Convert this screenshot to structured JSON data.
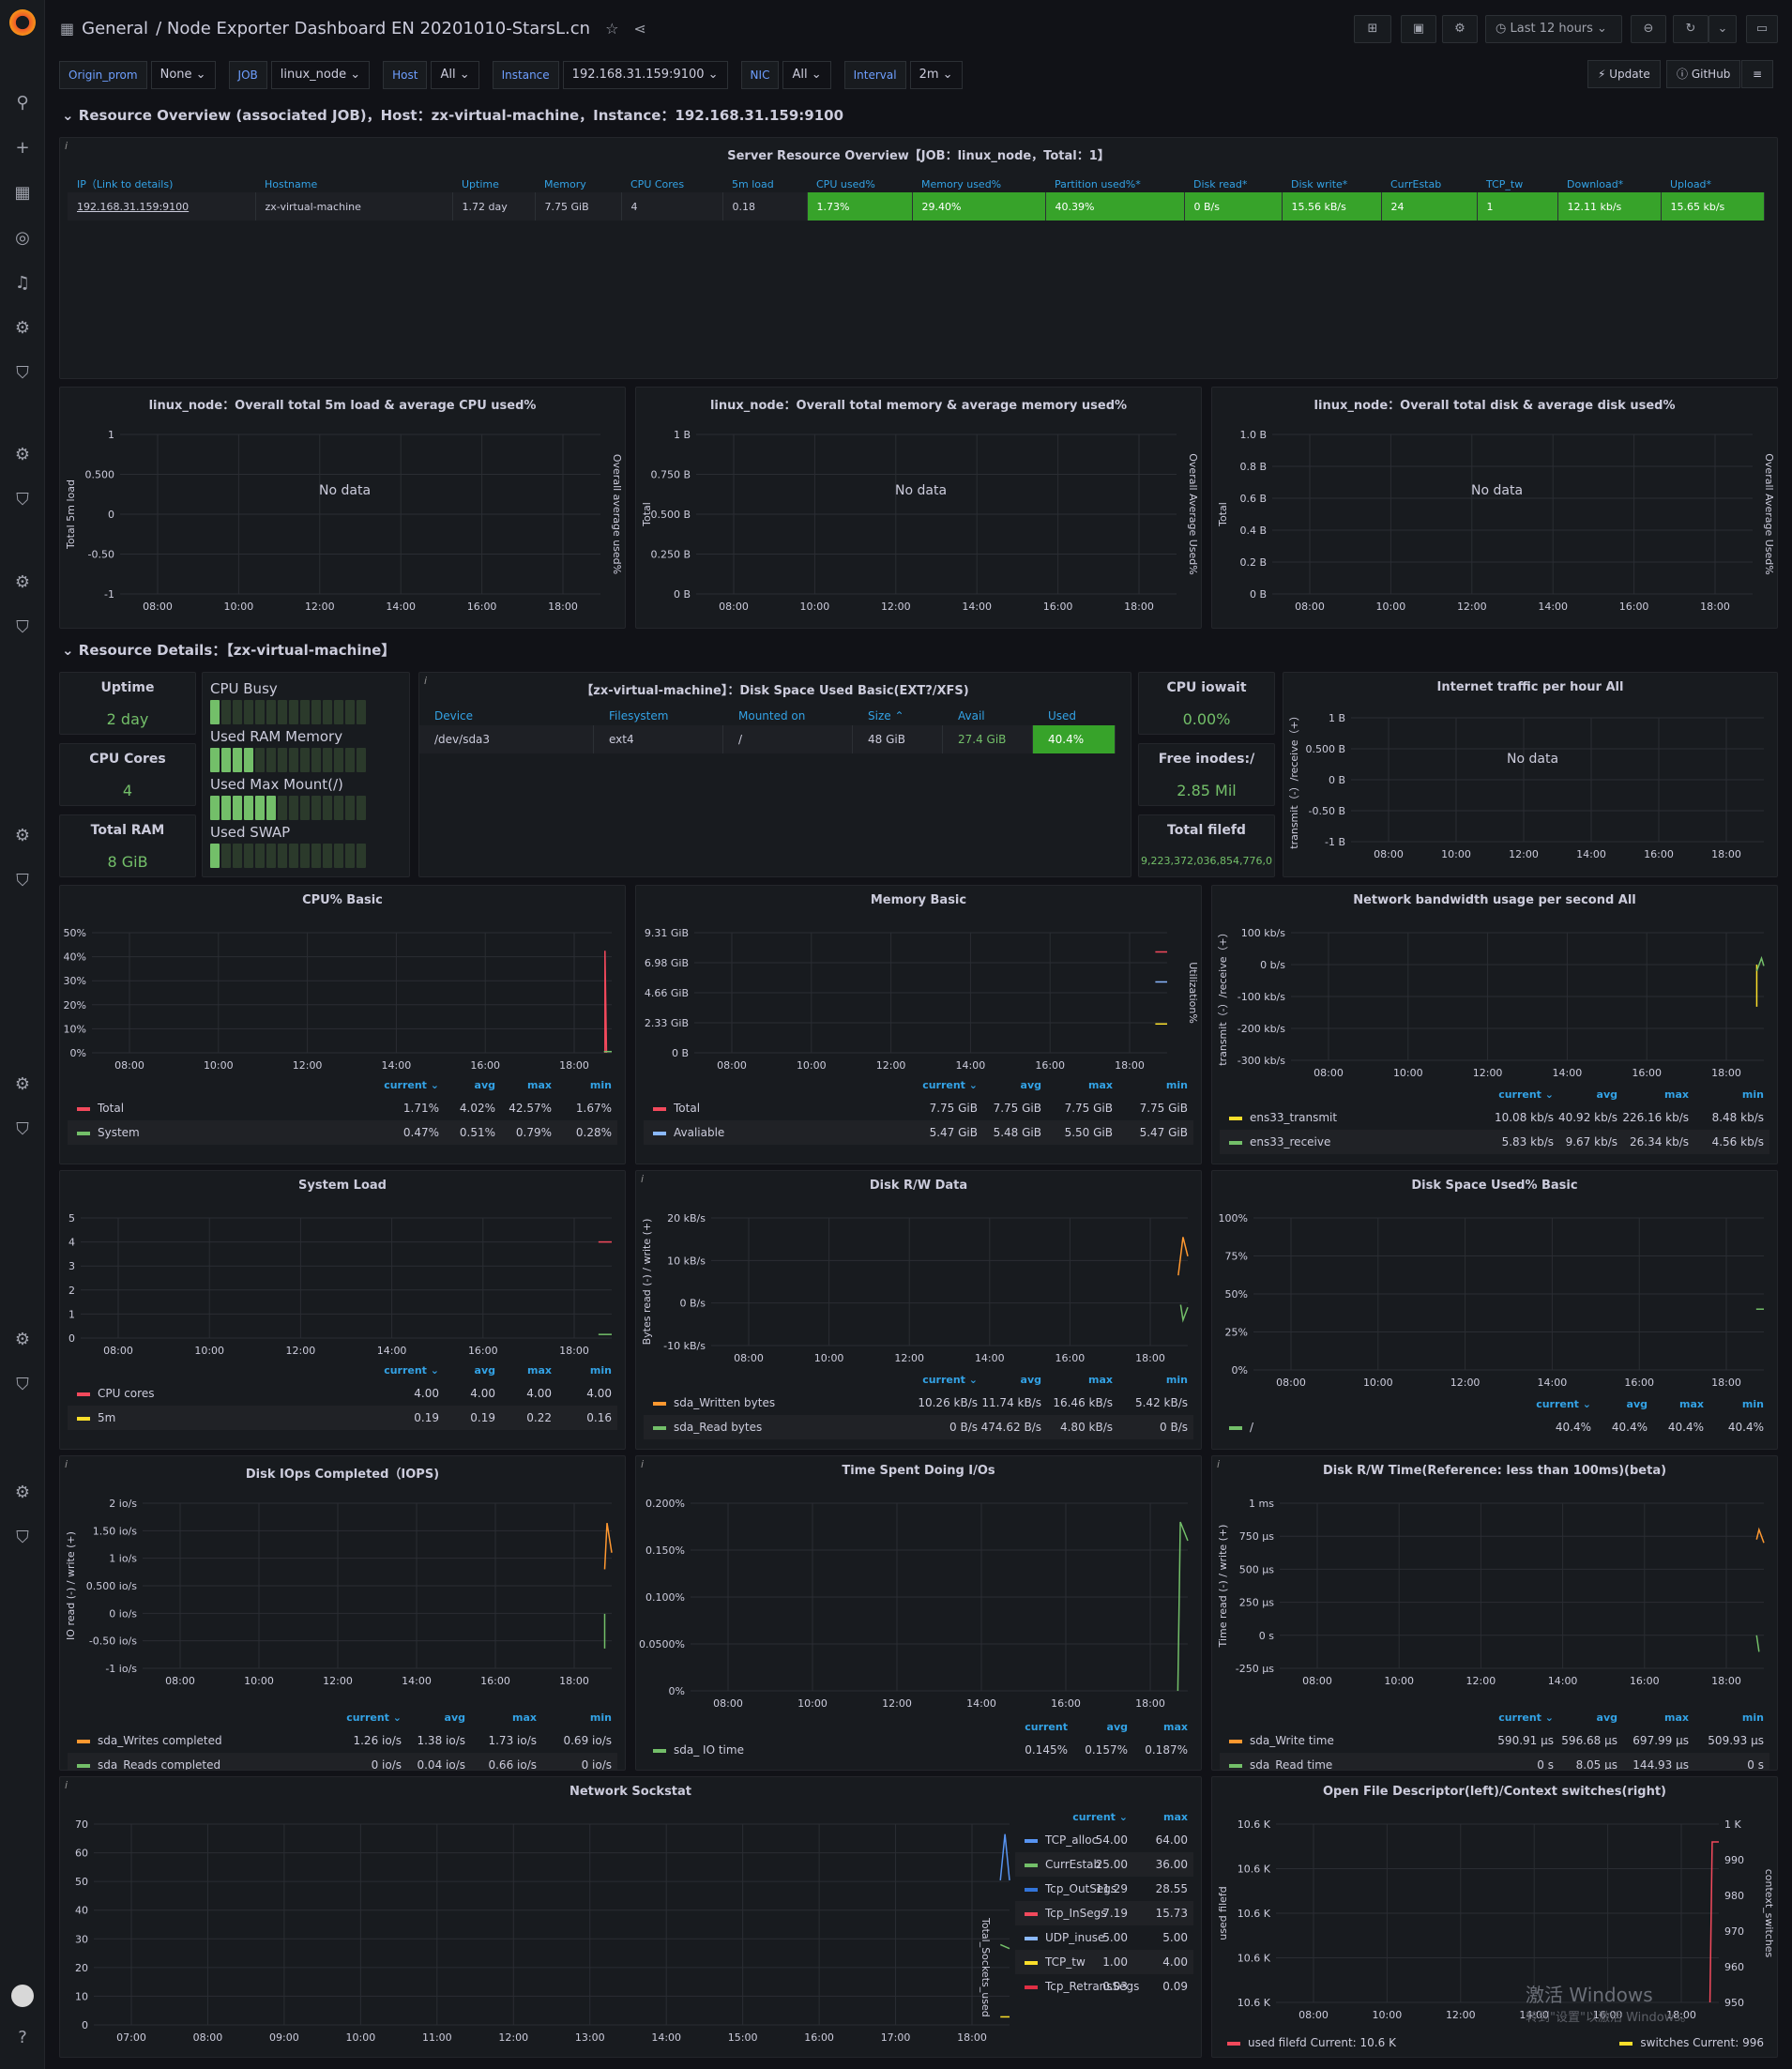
{
  "topbar": {
    "folder": "General",
    "title": "/ Node Exporter Dashboard EN 20201010-StarsL.cn",
    "time_range": "Last 12 hours"
  },
  "variables": [
    {
      "label": "Origin_prom",
      "value": "None"
    },
    {
      "label": "JOB",
      "value": "linux_node"
    },
    {
      "label": "Host",
      "value": "All"
    },
    {
      "label": "Instance",
      "value": "192.168.31.159:9100"
    },
    {
      "label": "NIC",
      "value": "All"
    },
    {
      "label": "Interval",
      "value": "2m"
    }
  ],
  "links": {
    "update": "Update",
    "github": "GitHub"
  },
  "rows": {
    "overview": "Resource Overview (associated JOB)，Host：zx-virtual-machine，Instance：192.168.31.159:9100",
    "details": "Resource Details：【zx-virtual-machine】"
  },
  "server_overview": {
    "title": "Server Resource Overview【JOB：linux_node，Total：1】",
    "headers": [
      "IP（Link to details)",
      "Hostname",
      "Uptime",
      "Memory",
      "CPU Cores",
      "5m load",
      "CPU used%",
      "Memory used%",
      "Partition used%*",
      "Disk read*",
      "Disk write*",
      "CurrEstab",
      "TCP_tw",
      "Download*",
      "Upload*"
    ],
    "row": [
      "192.168.31.159:9100",
      "zx-virtual-machine",
      "1.72 day",
      "7.75 GiB",
      "4",
      "0.18",
      "1.73%",
      "29.40%",
      "40.39%",
      "0 B/s",
      "15.56 kB/s",
      "24",
      "1",
      "12.11 kb/s",
      "15.65 kb/s"
    ]
  },
  "overall_panels": [
    {
      "title": "linux_node：Overall total 5m load & average CPU used%",
      "nodata": "No data",
      "yticks": [
        "1",
        "0.500",
        "0",
        "-0.50",
        "-1"
      ],
      "ylabel": "Total 5m load",
      "y2label": "Overall average used%"
    },
    {
      "title": "linux_node：Overall total memory & average memory used%",
      "nodata": "No data",
      "yticks": [
        "1 B",
        "0.750 B",
        "0.500 B",
        "0.250 B",
        "0 B"
      ],
      "ylabel": "Total",
      "y2label": "Overall Average Used%"
    },
    {
      "title": "linux_node：Overall total disk & average disk used%",
      "nodata": "No data",
      "yticks": [
        "1.0 B",
        "0.8 B",
        "0.6 B",
        "0.4 B",
        "0.2 B",
        "0 B"
      ],
      "ylabel": "Total",
      "y2label": "Overall Average Used%"
    }
  ],
  "xticks": [
    "08:00",
    "10:00",
    "12:00",
    "14:00",
    "16:00",
    "18:00"
  ],
  "xticks_long": [
    "07:00",
    "08:00",
    "09:00",
    "10:00",
    "11:00",
    "12:00",
    "13:00",
    "14:00",
    "15:00",
    "16:00",
    "17:00",
    "18:00"
  ],
  "stats": {
    "uptime": {
      "title": "Uptime",
      "value": "2 day"
    },
    "cores": {
      "title": "CPU Cores",
      "value": "4"
    },
    "ram": {
      "title": "Total RAM",
      "value": "8 GiB"
    },
    "iowait": {
      "title": "CPU iowait",
      "value": "0.00%"
    },
    "inodes": {
      "title": "Free inodes:/",
      "value": "2.85 Mil"
    },
    "filefd": {
      "title": "Total filefd",
      "value": "9,223,372,036,854,776,0"
    }
  },
  "gauges": [
    {
      "label": "CPU Busy",
      "value": "1.7%",
      "level": 0.017
    },
    {
      "label": "Used RAM Memory",
      "value": "29.4%",
      "level": 0.294
    },
    {
      "label": "Used Max Mount(/)",
      "value": "40.4%",
      "level": 0.404
    },
    {
      "label": "Used SWAP",
      "value": "4.2%",
      "level": 0.042
    }
  ],
  "disk_table": {
    "title": "【zx-virtual-machine】：Disk Space Used Basic(EXT?/XFS)",
    "headers": [
      "Device",
      "Filesystem",
      "Mounted on",
      "Size",
      "Avail",
      "Used"
    ],
    "row": [
      "/dev/sda3",
      "ext4",
      "/",
      "48 GiB",
      "27.4 GiB",
      "40.4%"
    ]
  },
  "internet_traffic": {
    "title": "Internet traffic per hour All",
    "nodata": "No data",
    "yticks": [
      "1 B",
      "0.500 B",
      "0 B",
      "-0.50 B",
      "-1 B"
    ],
    "ylabel": "transmit（-）/receive（+）"
  },
  "cpu_basic": {
    "title": "CPU% Basic",
    "yticks": [
      "50%",
      "40%",
      "30%",
      "20%",
      "10%",
      "0%"
    ],
    "legend_cols": [
      "min",
      "max",
      "avg",
      "current ⌄"
    ],
    "series": [
      {
        "name": "Total",
        "color": "#f2495c",
        "vals": [
          "1.67%",
          "42.57%",
          "4.02%",
          "1.71%"
        ]
      },
      {
        "name": "System",
        "color": "#73bf69",
        "vals": [
          "0.28%",
          "0.79%",
          "0.51%",
          "0.47%"
        ]
      }
    ]
  },
  "memory_basic": {
    "title": "Memory Basic",
    "yticks": [
      "9.31 GiB",
      "6.98 GiB",
      "4.66 GiB",
      "2.33 GiB",
      "0 B"
    ],
    "y2label": "Utilization%",
    "legend_cols": [
      "min",
      "max",
      "avg",
      "current ⌄"
    ],
    "series": [
      {
        "name": "Total",
        "color": "#f2495c",
        "vals": [
          "7.75 GiB",
          "7.75 GiB",
          "7.75 GiB",
          "7.75 GiB"
        ]
      },
      {
        "name": "Avaliable",
        "color": "#8ab8ff",
        "vals": [
          "5.47 GiB",
          "5.50 GiB",
          "5.48 GiB",
          "5.47 GiB"
        ]
      }
    ]
  },
  "net_bandwidth": {
    "title": "Network bandwidth usage per second All",
    "yticks": [
      "100 kb/s",
      "0 b/s",
      "-100 kb/s",
      "-200 kb/s",
      "-300 kb/s"
    ],
    "ylabel": "transmit（-）/receive（+）",
    "legend_cols": [
      "min",
      "max",
      "avg",
      "current ⌄"
    ],
    "series": [
      {
        "name": "ens33_transmit",
        "color": "#fade2a",
        "vals": [
          "8.48 kb/s",
          "226.16 kb/s",
          "40.92 kb/s",
          "10.08 kb/s"
        ]
      },
      {
        "name": "ens33_receive",
        "color": "#73bf69",
        "vals": [
          "4.56 kb/s",
          "26.34 kb/s",
          "9.67 kb/s",
          "5.83 kb/s"
        ]
      }
    ]
  },
  "system_load": {
    "title": "System Load",
    "yticks": [
      "5",
      "4",
      "3",
      "2",
      "1",
      "0"
    ],
    "legend_cols": [
      "min",
      "max",
      "avg",
      "current ⌄"
    ],
    "series": [
      {
        "name": "CPU cores",
        "color": "#f2495c",
        "vals": [
          "4.00",
          "4.00",
          "4.00",
          "4.00"
        ]
      },
      {
        "name": "5m",
        "color": "#fade2a",
        "vals": [
          "0.16",
          "0.22",
          "0.19",
          "0.19"
        ]
      }
    ]
  },
  "disk_rw": {
    "title": "Disk R/W Data",
    "yticks": [
      "20 kB/s",
      "10 kB/s",
      "0 B/s",
      "-10 kB/s"
    ],
    "ylabel": "Bytes read (-) / write (+)",
    "legend_cols": [
      "min",
      "max",
      "avg",
      "current ⌄"
    ],
    "series": [
      {
        "name": "sda_Written bytes",
        "color": "#ff9830",
        "vals": [
          "5.42 kB/s",
          "16.46 kB/s",
          "11.74 kB/s",
          "10.26 kB/s"
        ]
      },
      {
        "name": "sda_Read bytes",
        "color": "#73bf69",
        "vals": [
          "0 B/s",
          "4.80 kB/s",
          "474.62 B/s",
          "0 B/s"
        ]
      }
    ]
  },
  "disk_space": {
    "title": "Disk Space Used% Basic",
    "yticks": [
      "100%",
      "75%",
      "50%",
      "25%",
      "0%"
    ],
    "legend_cols": [
      "min",
      "max",
      "avg",
      "current ⌄"
    ],
    "series": [
      {
        "name": "/",
        "color": "#73bf69",
        "vals": [
          "40.4%",
          "40.4%",
          "40.4%",
          "40.4%"
        ]
      }
    ]
  },
  "disk_iops": {
    "title": "Disk IOps Completed（IOPS)",
    "yticks": [
      "2 io/s",
      "1.50 io/s",
      "1 io/s",
      "0.500 io/s",
      "0 io/s",
      "-0.50 io/s",
      "-1 io/s"
    ],
    "ylabel": "IO read (-) / write (+)",
    "legend_cols": [
      "min",
      "max",
      "avg",
      "current ⌄"
    ],
    "series": [
      {
        "name": "sda_Writes completed",
        "color": "#ff9830",
        "vals": [
          "0.69 io/s",
          "1.73 io/s",
          "1.38 io/s",
          "1.26 io/s"
        ]
      },
      {
        "name": "sda_Reads completed",
        "color": "#73bf69",
        "vals": [
          "0 io/s",
          "0.66 io/s",
          "0.04 io/s",
          "0 io/s"
        ]
      }
    ]
  },
  "time_io": {
    "title": "Time Spent Doing I/Os",
    "yticks": [
      "0.200%",
      "0.150%",
      "0.100%",
      "0.0500%",
      "0%"
    ],
    "legend_cols": [
      "max",
      "avg",
      "current"
    ],
    "series": [
      {
        "name": "sda_ IO time",
        "color": "#73bf69",
        "vals": [
          "0.187%",
          "0.157%",
          "0.145%"
        ]
      }
    ]
  },
  "disk_rw_time": {
    "title": "Disk R/W Time(Reference: less than 100ms)(beta)",
    "yticks": [
      "1 ms",
      "750 µs",
      "500 µs",
      "250 µs",
      "0 s",
      "-250 µs"
    ],
    "ylabel": "Time read (-) / write (+)",
    "legend_cols": [
      "min",
      "max",
      "avg",
      "current ⌄"
    ],
    "series": [
      {
        "name": "sda_Write time",
        "color": "#ff9830",
        "vals": [
          "509.93 µs",
          "697.99 µs",
          "596.68 µs",
          "590.91 µs"
        ]
      },
      {
        "name": "sda_Read time",
        "color": "#73bf69",
        "vals": [
          "0 s",
          "144.93 µs",
          "8.05 µs",
          "0 s"
        ]
      }
    ]
  },
  "sockstat": {
    "title": "Network Sockstat",
    "yticks": [
      "70",
      "60",
      "50",
      "40",
      "30",
      "20",
      "10",
      "0"
    ],
    "y2label": "Total_Sockets_used",
    "legend_cols": [
      "max",
      "current ⌄"
    ],
    "series": [
      {
        "name": "TCP_alloc",
        "color": "#5794f2",
        "vals": [
          "64.00",
          "54.00"
        ]
      },
      {
        "name": "CurrEstab",
        "color": "#73bf69",
        "vals": [
          "36.00",
          "25.00"
        ]
      },
      {
        "name": "Tcp_OutSegs",
        "color": "#3274d9",
        "vals": [
          "28.55",
          "11.29"
        ]
      },
      {
        "name": "Tcp_InSegs",
        "color": "#f2495c",
        "vals": [
          "15.73",
          "7.19"
        ]
      },
      {
        "name": "UDP_inuse",
        "color": "#8ab8ff",
        "vals": [
          "5.00",
          "5.00"
        ]
      },
      {
        "name": "TCP_tw",
        "color": "#fade2a",
        "vals": [
          "4.00",
          "1.00"
        ]
      },
      {
        "name": "Tcp_RetransSegs",
        "color": "#e02f44",
        "vals": [
          "0.09",
          "0.03"
        ]
      }
    ]
  },
  "openfile": {
    "title": "Open File Descriptor(left)/Context switches(right)",
    "yticks": [
      "10.6 K",
      "10.6 K",
      "10.6 K",
      "10.6 K",
      "10.6 K"
    ],
    "y2ticks": [
      "1 K",
      "990",
      "980",
      "970",
      "960",
      "950"
    ],
    "ylabel": "used filefd",
    "y2label": "context_switches",
    "leg_left": "used filefd  Current: 10.6 K",
    "leg_right": "switches  Current: 996"
  },
  "watermark": {
    "line1": "激活 Windows",
    "line2": "转到\"设置\"以激活 Windows。"
  }
}
